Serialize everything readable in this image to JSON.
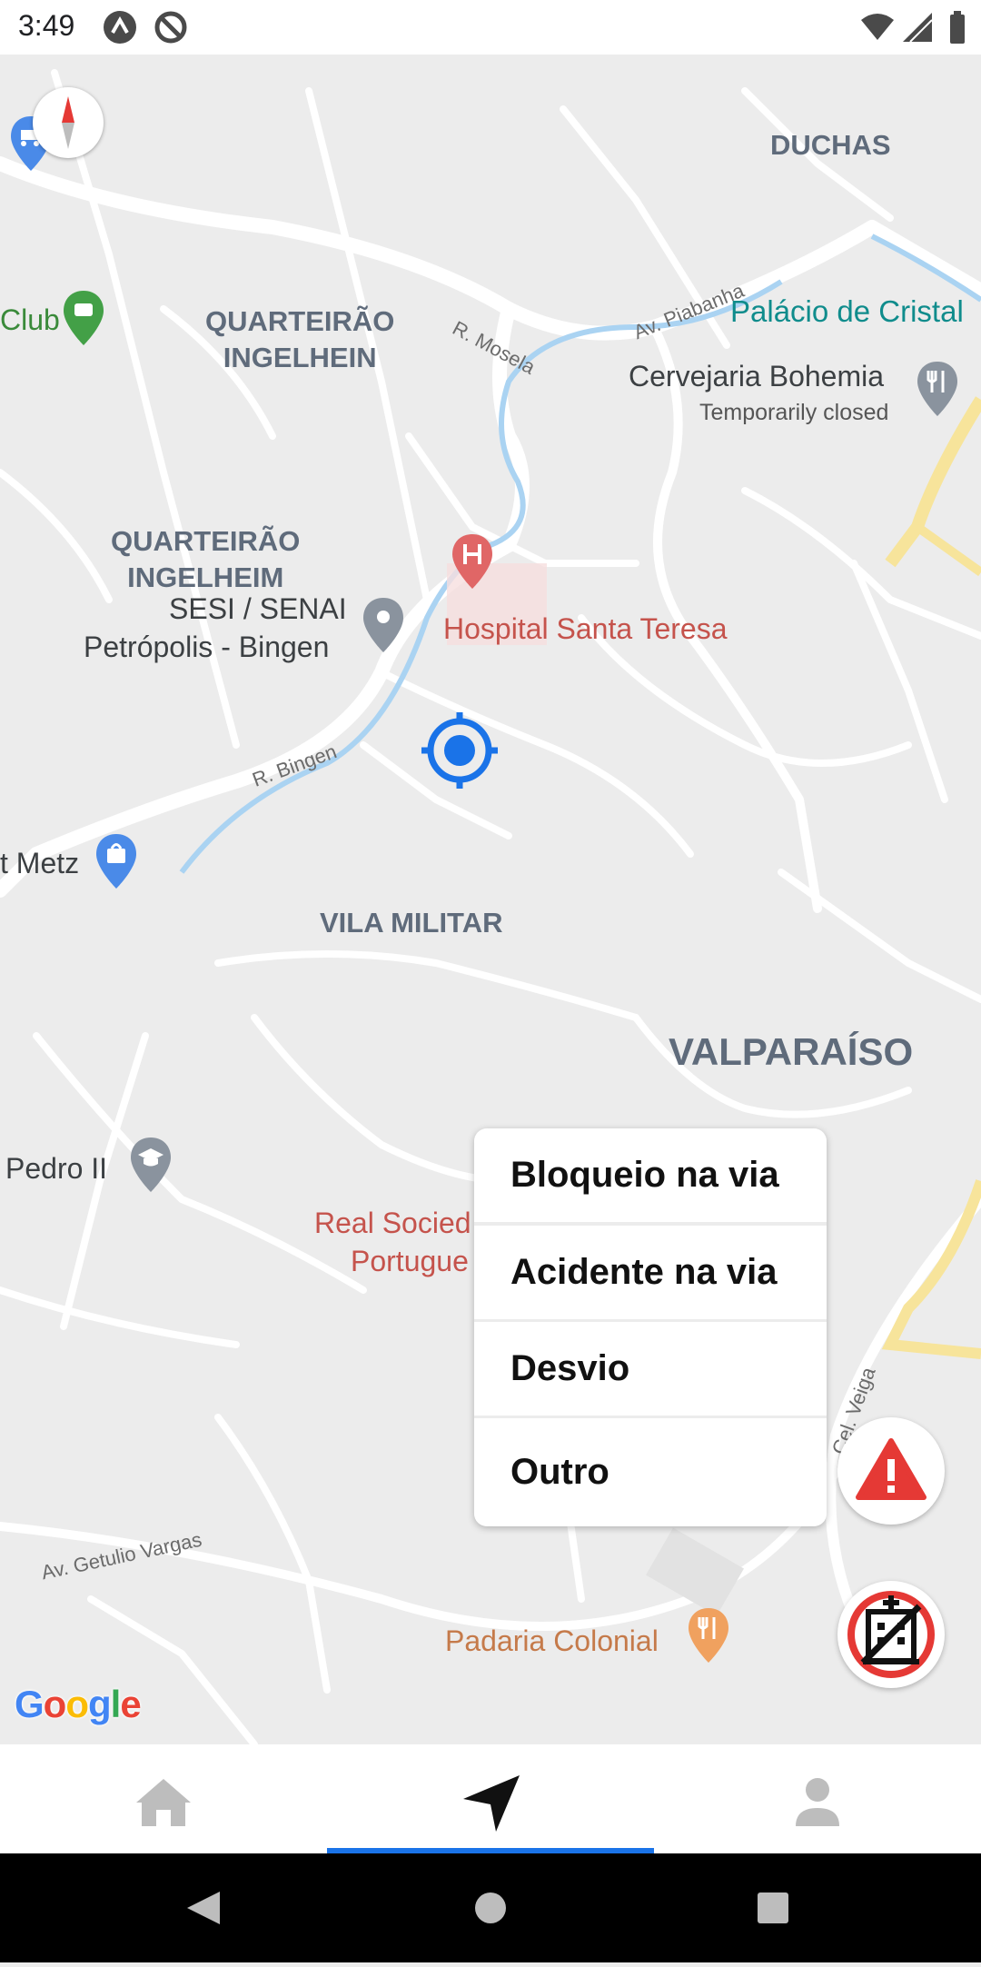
{
  "status_bar": {
    "time": "3:49",
    "icons": [
      "app-notification-icon",
      "sync-disabled-icon",
      "wifi-icon",
      "signal-icon",
      "battery-icon"
    ]
  },
  "map": {
    "area_labels": {
      "duchas": "DUCHAS",
      "quarteirao_ingelhein_1": "QUARTEIRÃO",
      "quarteirao_ingelhein_2": "INGELHEIN",
      "quarteirao_ingelheim_1": "QUARTEIRÃO",
      "quarteirao_ingelheim_2": "INGELHEIM",
      "vila_militar": "VILA MILITAR",
      "valparaiso": "VALPARAÍSO"
    },
    "pois": {
      "club": "Club",
      "palacio": "Palácio de Cristal",
      "cervejaria": "Cervejaria Bohemia",
      "cervejaria_status": "Temporarily closed",
      "hospital": "Hospital Santa Teresa",
      "sesi_1": "SESI / SENAI",
      "sesi_2": "Petrópolis - Bingen",
      "metz": "t Metz",
      "pedro": "Pedro II",
      "real_1": "Real Socied",
      "real_2": "Portugue",
      "padaria": "Padaria Colonial"
    },
    "streets": {
      "mosela": "R. Mosela",
      "piabanha": "Av. Piabanha",
      "bingen": "R. Bingen",
      "getulio": "Av. Getulio Vargas",
      "veiga": "Cel. Veiga"
    },
    "google_logo": [
      "G",
      "o",
      "o",
      "g",
      "l",
      "e"
    ]
  },
  "menu": {
    "items": [
      "Bloqueio na via",
      "Acidente na via",
      "Desvio",
      "Outro"
    ]
  },
  "colors": {
    "accent": "#1a73e8",
    "map_bg": "#ececec",
    "alert_red": "#e53935"
  },
  "nav": {
    "tabs": [
      "home-icon",
      "navigation-arrow-icon",
      "profile-icon"
    ],
    "active_tab": 1
  }
}
